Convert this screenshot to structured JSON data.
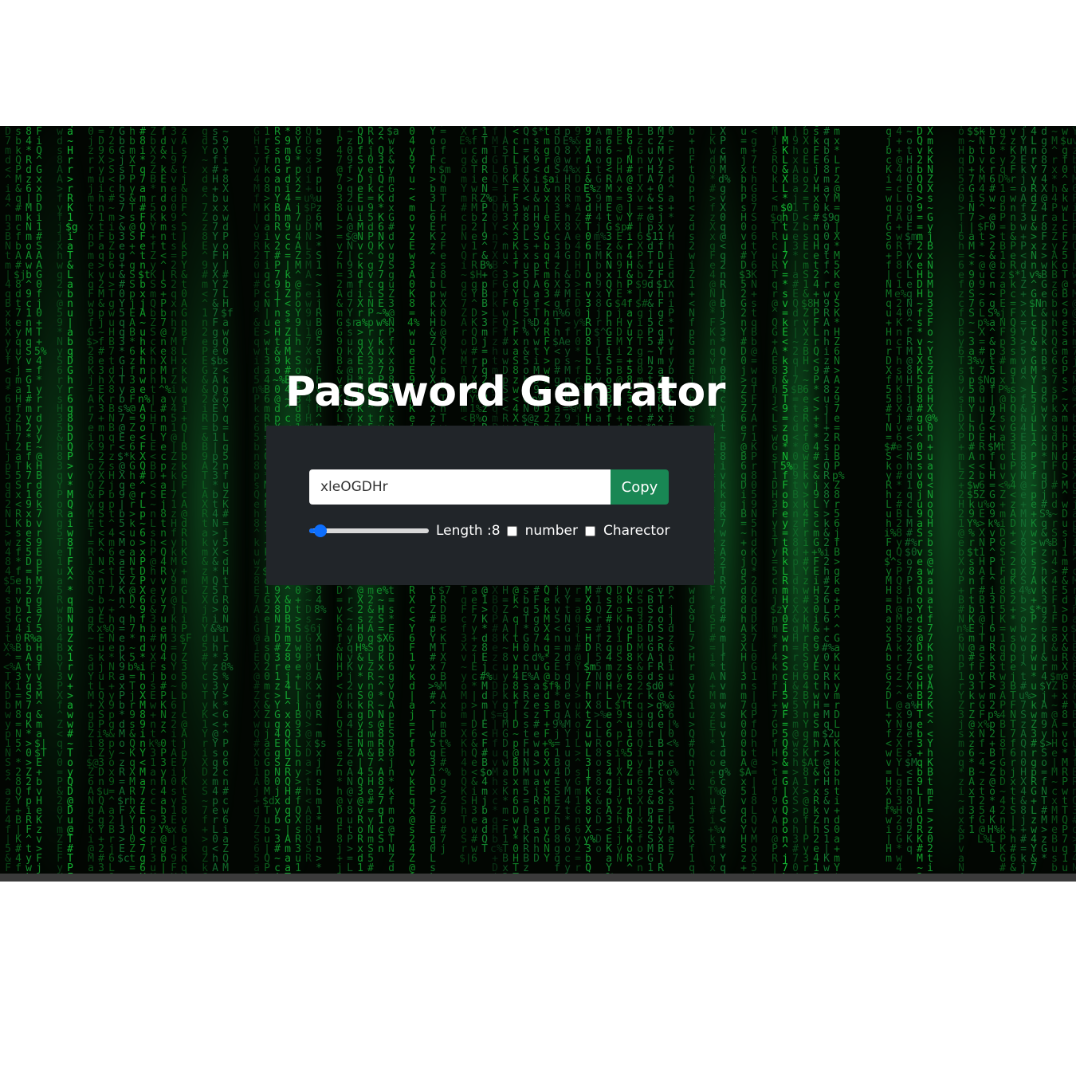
{
  "title": "Password Genrator",
  "password": {
    "value": "xleOGDHr"
  },
  "copy_button": {
    "label": "Copy"
  },
  "length": {
    "label": "Length :8",
    "value": 8,
    "min": 6,
    "max": 50
  },
  "options": [
    {
      "label": "number",
      "checked": false
    },
    {
      "label": "Charector",
      "checked": false
    }
  ],
  "colors": {
    "card_background": "#212529",
    "copy_button": "#198754",
    "slider_accent": "#0d6efd",
    "matrix_green": "#1fa64a"
  },
  "icons": {
    "background": "matrix-code-rain"
  }
}
